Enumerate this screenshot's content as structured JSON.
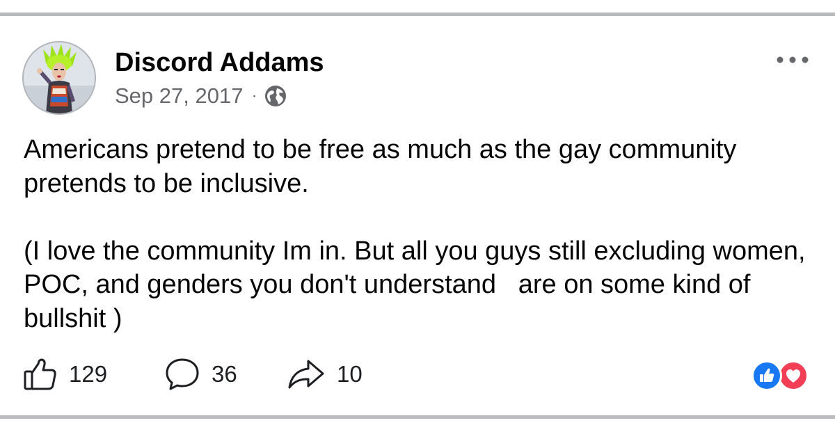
{
  "post": {
    "author_name": "Discord Addams",
    "date": "Sep 27, 2017",
    "separator": "·",
    "privacy_icon": "globe-icon",
    "paragraphs": [
      "Americans pretend to be free as much as the gay community pretends to be inclusive.",
      "(I love the community Im in. But all you guys still excluding women, POC, and genders you don't understand   are on some kind of bullshit )"
    ]
  },
  "actions": {
    "likes": "129",
    "comments": "36",
    "shares": "10"
  },
  "icons": {
    "more": "ellipsis-icon",
    "like": "thumbs-up-icon",
    "comment": "speech-bubble-icon",
    "share": "share-arrow-icon",
    "reaction_like": "like-reaction-icon",
    "reaction_love": "love-reaction-icon"
  },
  "colors": {
    "text_primary": "#050505",
    "text_secondary": "#65676b",
    "divider": "#b8babd",
    "like_blue": "#1877f2",
    "love_red": "#f33e58",
    "avatar_hair": "#9de21c"
  }
}
